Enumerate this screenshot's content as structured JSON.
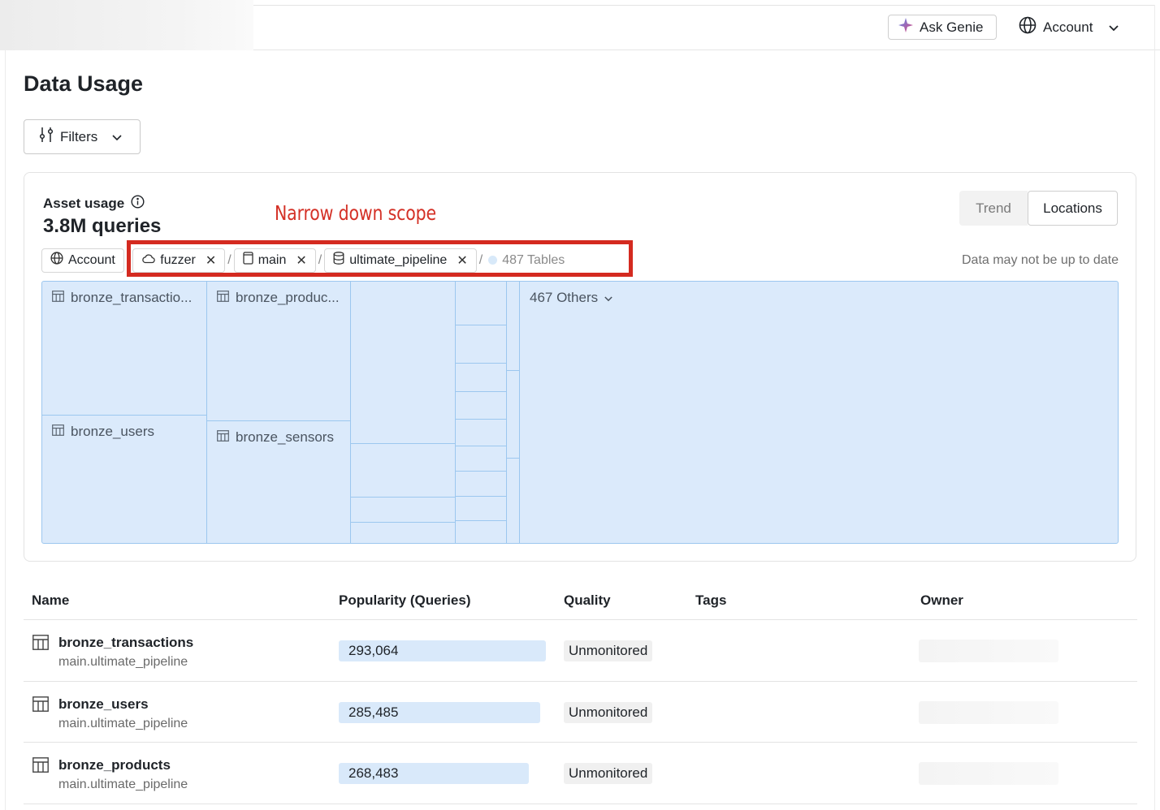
{
  "header": {
    "ask_genie_label": "Ask Genie",
    "account_label": "Account"
  },
  "page": {
    "title": "Data Usage",
    "filters_label": "Filters"
  },
  "asset_usage": {
    "label": "Asset usage",
    "metric": "3.8M queries",
    "views": [
      "Trend",
      "Locations"
    ],
    "selected_view": "Locations",
    "annotation": "Narrow down scope",
    "stale_note": "Data may not be up to date",
    "breadcrumb": {
      "root": "Account",
      "separator": "/",
      "chips": [
        {
          "label": "fuzzer",
          "icon": "cloud-icon"
        },
        {
          "label": "main",
          "icon": "catalog-icon"
        },
        {
          "label": "ultimate_pipeline",
          "icon": "database-icon"
        }
      ],
      "tables_count": "487 Tables"
    },
    "treemap": {
      "tiles": [
        {
          "label": "bronze_transactio...",
          "value": 293064
        },
        {
          "label": "bronze_users",
          "value": 285485
        },
        {
          "label": "bronze_produc...",
          "value": 268483
        },
        {
          "label": "bronze_sensors"
        }
      ],
      "others_label": "467 Others"
    }
  },
  "table": {
    "columns": [
      "Name",
      "Popularity (Queries)",
      "Quality",
      "Tags",
      "Owner"
    ],
    "max_queries": 293064,
    "rows": [
      {
        "name": "bronze_transactions",
        "path": "main.ultimate_pipeline",
        "queries": 293064,
        "queries_label": "293,064",
        "quality": "Unmonitored"
      },
      {
        "name": "bronze_users",
        "path": "main.ultimate_pipeline",
        "queries": 285485,
        "queries_label": "285,485",
        "quality": "Unmonitored"
      },
      {
        "name": "bronze_products",
        "path": "main.ultimate_pipeline",
        "queries": 268483,
        "queries_label": "268,483",
        "quality": "Unmonitored"
      }
    ]
  },
  "colors": {
    "annotation_red": "#d42a20",
    "treemap_fill": "#dbeafb",
    "treemap_border": "#9cc7ef",
    "popularity_bar": "#d9e9fa"
  }
}
